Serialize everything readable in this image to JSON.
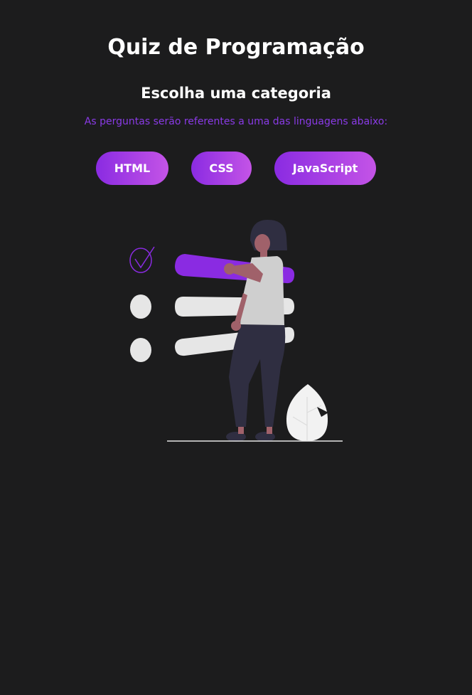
{
  "header": {
    "title": "Quiz de Programação",
    "subtitle": "Escolha uma categoria",
    "description": "As perguntas serão referentes a uma das linguagens abaixo:"
  },
  "categories": [
    {
      "label": "HTML"
    },
    {
      "label": "CSS"
    },
    {
      "label": "JavaScript"
    }
  ],
  "illustration": {
    "icon": "checklist-person-illustration",
    "colors": {
      "accent": "#8a2be2",
      "bars": "#e6e6e6",
      "shirt": "#cfcfcf",
      "pants": "#2f2e41",
      "skin": "#a0616a",
      "hair": "#2f2e41"
    }
  },
  "colors": {
    "background": "#1c1c1d",
    "accent": "#8a3ae6",
    "button_gradient_start": "#8a2be2",
    "button_gradient_end": "#c454e6",
    "text": "#ffffff"
  }
}
